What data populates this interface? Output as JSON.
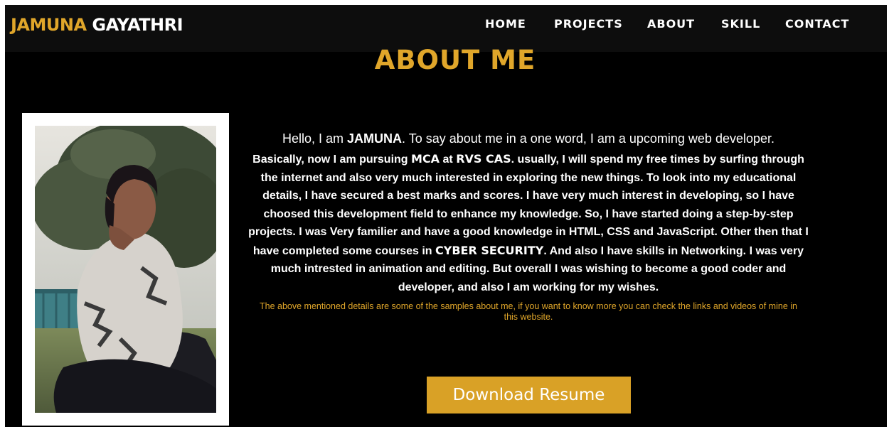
{
  "brand": {
    "first": "JAMUNA",
    "last": "GAYATHRI"
  },
  "nav": {
    "home": "HOME",
    "projects": "PROJECTS",
    "about": "ABOUT",
    "skill": "SKILL",
    "contact": "CONTACT"
  },
  "about": {
    "title": "ABOUT ME",
    "intro": {
      "prefix": "Hello, I am ",
      "name": "JAMUNA",
      "suffix": ". To say about me in a one word, I am a upcoming web developer."
    },
    "description": {
      "p1": "Basically, now I am pursuing ",
      "mca": "MCA",
      "p2": " at ",
      "college": "RVS CAS",
      "p3": ". usually, I will spend my free times by surfing through the internet and also very much interested in exploring the new things. To look into my educational details, I have secured a best marks and scores. I have very much interest in developing, so I have choosed this development field to enhance my knowledge. So, I have started doing a step-by-step projects. I was Very familier and have a good knowledge in HTML, CSS and JavaScript. Other then that I have completed some courses in ",
      "cyber": "CYBER SECURITY",
      "p4": ". And also I have skills in Networking. I was very much intrested in animation and editing. But overall I was wishing to become a good coder and developer, and also I am working for my wishes."
    },
    "note": "The above mentioned details are some of the samples about me, if you want to know more you can check the links and videos of mine in this website.",
    "resume_button": "Download Resume"
  },
  "colors": {
    "accent": "#e0a62a",
    "button": "#d9a126",
    "background": "#000000",
    "navbar": "#0d0d0d"
  }
}
